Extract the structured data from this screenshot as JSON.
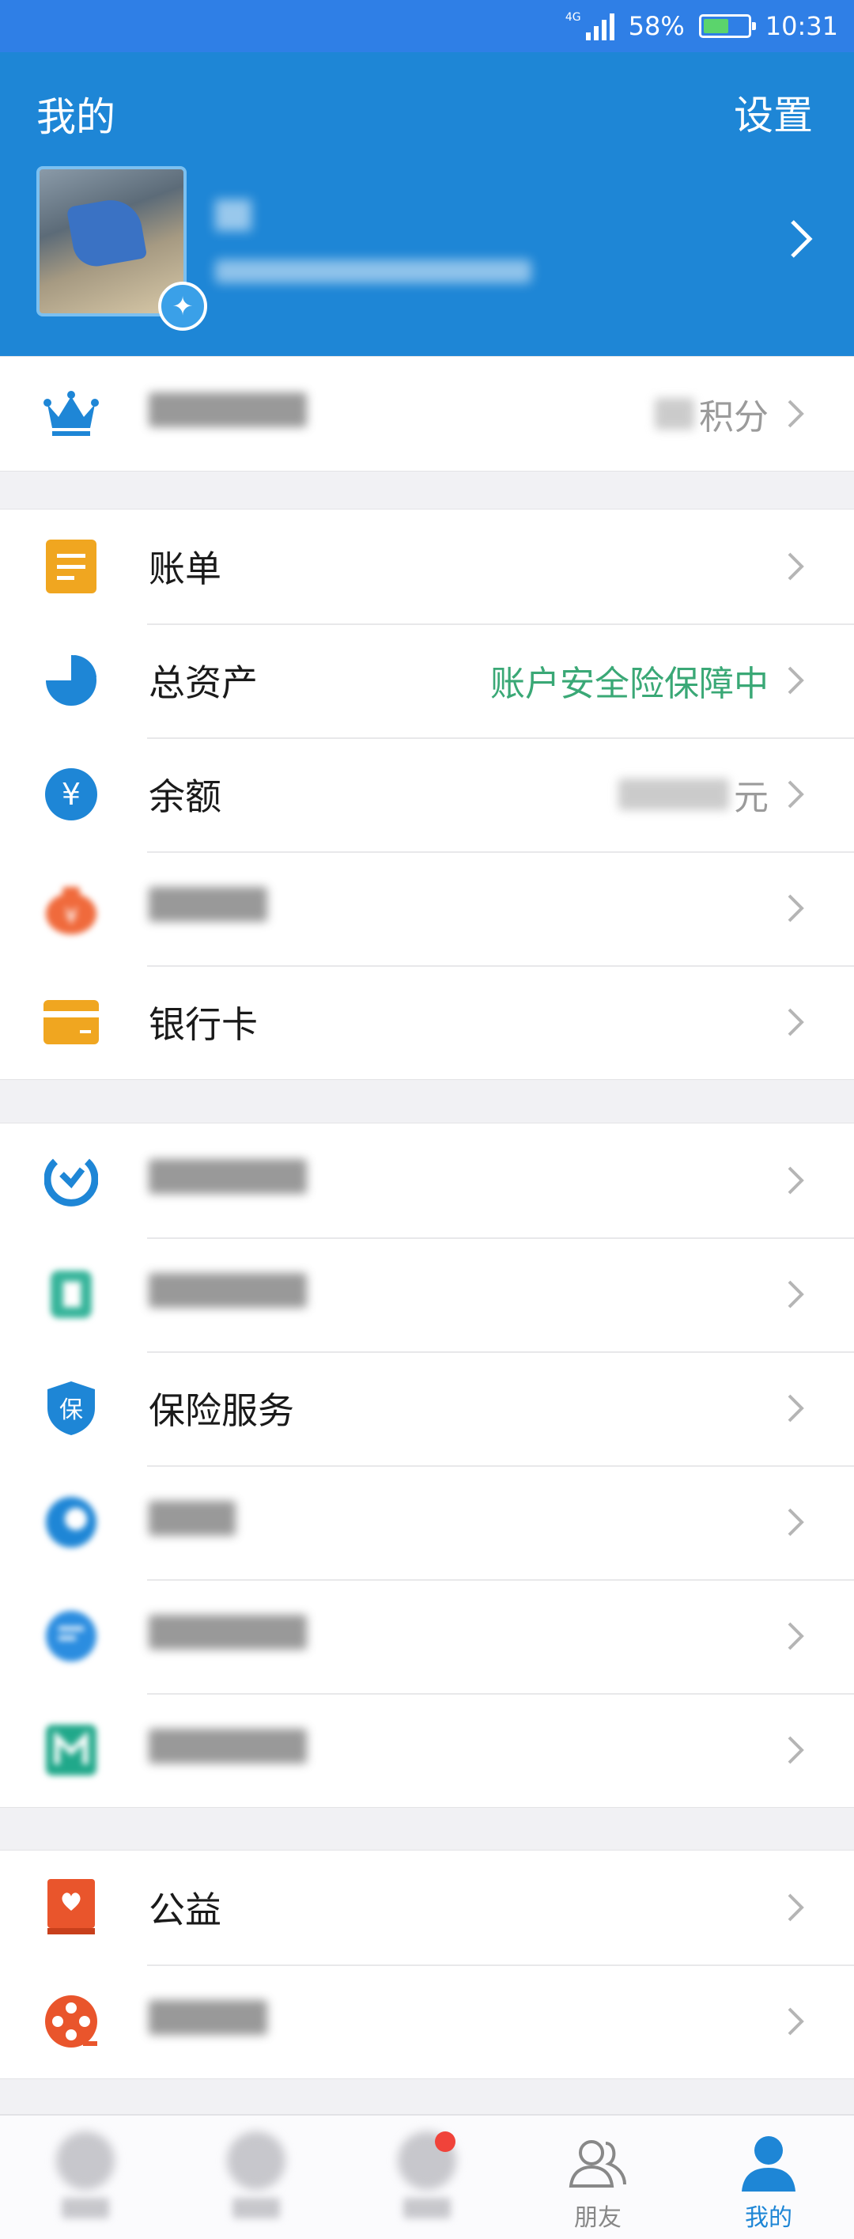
{
  "status_bar": {
    "network": "4G",
    "battery": "58%",
    "time": "10:31",
    "colors": {
      "background": "#2f7fe6",
      "battery_fill": "#5bd46c"
    }
  },
  "header": {
    "title": "我的",
    "settings": "设置",
    "color": "#1e86d6"
  },
  "member_row": {
    "points_unit": "积分"
  },
  "group1": [
    {
      "label": "账单",
      "icon": "bill-icon"
    },
    {
      "label": "总资产",
      "icon": "total-assets-pie-icon",
      "right": "账户安全险保障中"
    },
    {
      "label": "余额",
      "icon": "yuan-balance-icon",
      "unit": "元"
    },
    {
      "icon": "money-bag-icon"
    },
    {
      "label": "银行卡",
      "icon": "bank-card-icon"
    }
  ],
  "group2": [
    {
      "icon": "wealth-icon"
    },
    {
      "icon": "credit-icon"
    },
    {
      "label": "保险服务",
      "icon": "insurance-shield-icon"
    },
    {
      "icon": "blue-circle-icon"
    },
    {
      "icon": "chat-bubble-icon"
    },
    {
      "icon": "bank-m-icon"
    }
  ],
  "group3": [
    {
      "label": "公益",
      "icon": "charity-heart-icon"
    },
    {
      "icon": "film-reel-icon"
    }
  ],
  "tabbar": {
    "friends": "朋友",
    "mine": "我的"
  }
}
